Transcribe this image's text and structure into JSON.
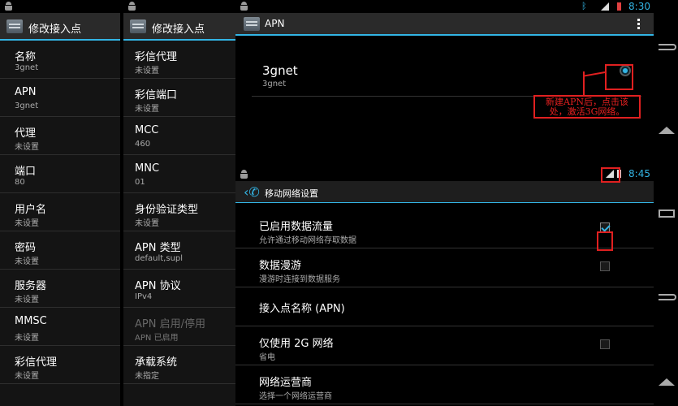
{
  "panel1": {
    "title": "修改接入点",
    "items": [
      {
        "label": "名称",
        "value": "3gnet"
      },
      {
        "label": "APN",
        "value": "3gnet"
      },
      {
        "label": "代理",
        "value": "未设置"
      },
      {
        "label": "端口",
        "value": "80"
      },
      {
        "label": "用户名",
        "value": "未设置"
      },
      {
        "label": "密码",
        "value": "未设置"
      },
      {
        "label": "服务器",
        "value": "未设置"
      },
      {
        "label": "MMSC",
        "value": "未设置"
      },
      {
        "label": "彩信代理",
        "value": "未设置"
      }
    ]
  },
  "panel2": {
    "title": "修改接入点",
    "items": [
      {
        "label": "彩信代理",
        "value": "未设置"
      },
      {
        "label": "彩信端口",
        "value": "未设置"
      },
      {
        "label": "MCC",
        "value": "460"
      },
      {
        "label": "MNC",
        "value": "01"
      },
      {
        "label": "身份验证类型",
        "value": "未设置"
      },
      {
        "label": "APN 类型",
        "value": "default,supl"
      },
      {
        "label": "APN 协议",
        "value": "IPv4"
      },
      {
        "label": "APN 启用/停用",
        "value": "APN 已启用"
      },
      {
        "label": "承载系统",
        "value": "未指定"
      }
    ]
  },
  "apn_screen": {
    "time": "8:30",
    "title": "APN",
    "entry_name": "3gnet",
    "entry_apn": "3gnet",
    "annotation_line1": "新建APN后，点击该",
    "annotation_line2": "处，激活3G网络。"
  },
  "mobile_screen": {
    "time": "8:45",
    "title": "移动网络设置",
    "rows": [
      {
        "label": "已启用数据流量",
        "sub": "允许通过移动网络存取数据"
      },
      {
        "label": "数据漫游",
        "sub": "漫游时连接到数据服务"
      },
      {
        "label": "接入点名称 (APN)"
      },
      {
        "label": "仅使用 2G 网络",
        "sub": "省电"
      },
      {
        "label": "网络运营商",
        "sub": "选择一个网络运营商"
      }
    ]
  },
  "colors": {
    "accent": "#33b5e5",
    "annotation": "#e02020"
  },
  "icons": [
    "android-notification-icon",
    "settings-app-icon",
    "overflow-menu-icon",
    "phone-icon",
    "signal-icon",
    "battery-icon",
    "bluetooth-icon",
    "back-nav-icon",
    "home-nav-icon",
    "recent-apps-nav-icon"
  ]
}
